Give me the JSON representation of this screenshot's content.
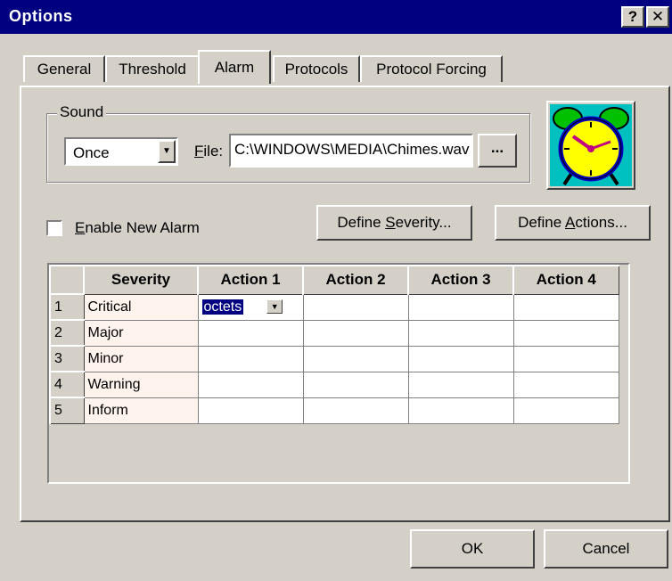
{
  "window": {
    "title": "Options",
    "help_glyph": "?",
    "close_glyph": "✕"
  },
  "tabs": [
    {
      "label": "General"
    },
    {
      "label": "Threshold"
    },
    {
      "label": "Alarm",
      "active": true
    },
    {
      "label": "Protocols"
    },
    {
      "label": "Protocol Forcing"
    }
  ],
  "sound": {
    "group_label": "Sound",
    "mode_value": "Once",
    "file_label_accel": "F",
    "file_label_rest": "ile:",
    "file_path": "C:\\WINDOWS\\MEDIA\\Chimes.wav",
    "browse_label": "..."
  },
  "enable_alarm": {
    "accel": "E",
    "rest": "nable New Alarm",
    "checked": false
  },
  "buttons": {
    "define_severity_pre": "Define ",
    "define_severity_accel": "S",
    "define_severity_post": "everity...",
    "define_actions_pre": "Define ",
    "define_actions_accel": "A",
    "define_actions_post": "ctions...",
    "ok": "OK",
    "cancel": "Cancel"
  },
  "grid": {
    "headers": [
      "",
      "Severity",
      "Action 1",
      "Action 2",
      "Action 3",
      "Action 4"
    ],
    "rows": [
      {
        "num": "1",
        "severity": "Critical",
        "action1": "octets",
        "action2": "",
        "action3": "",
        "action4": ""
      },
      {
        "num": "2",
        "severity": "Major",
        "action1": "",
        "action2": "",
        "action3": "",
        "action4": ""
      },
      {
        "num": "3",
        "severity": "Minor",
        "action1": "",
        "action2": "",
        "action3": "",
        "action4": ""
      },
      {
        "num": "4",
        "severity": "Warning",
        "action1": "",
        "action2": "",
        "action3": "",
        "action4": ""
      },
      {
        "num": "5",
        "severity": "Inform",
        "action1": "",
        "action2": "",
        "action3": "",
        "action4": ""
      }
    ]
  },
  "icons": {
    "alarm": "alarm-clock-icon",
    "dropdown": "dropdown-arrow-icon"
  },
  "colors": {
    "titlebar": "#000080",
    "face": "#d4d0c8",
    "clock_face": "#ffff00",
    "clock_bells": "#00c000",
    "selection": "#000080"
  }
}
